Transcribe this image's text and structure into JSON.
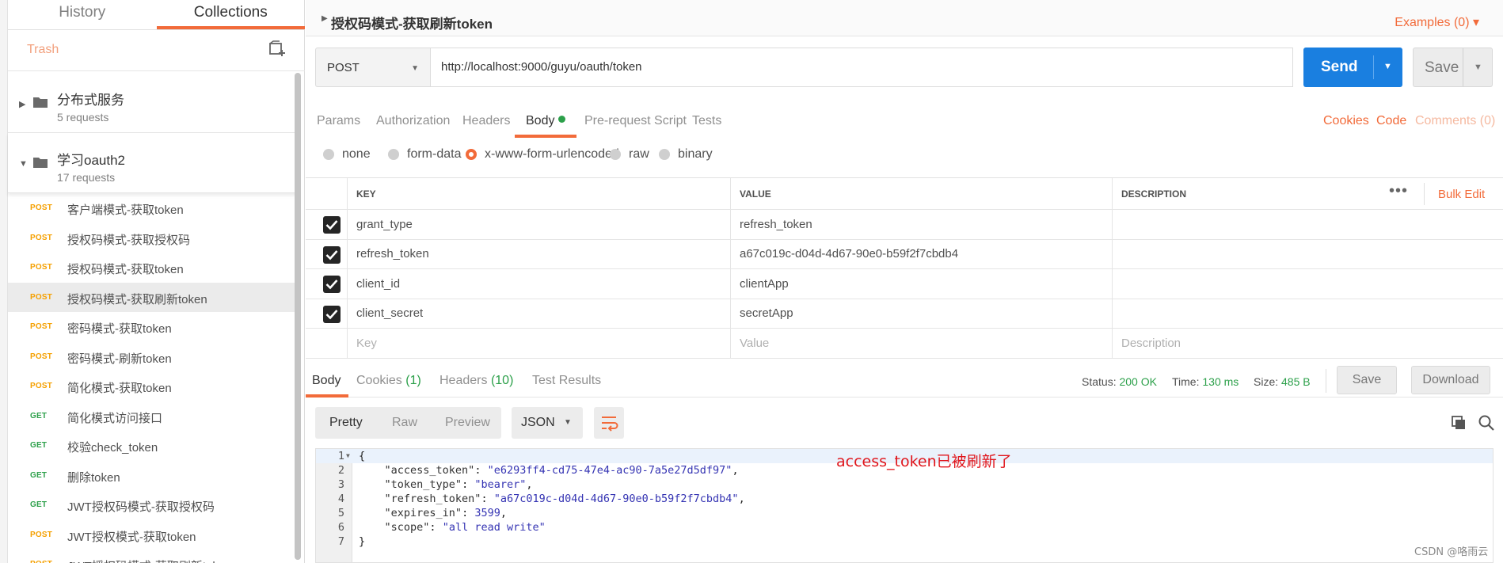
{
  "sidebar": {
    "tabs": [
      "History",
      "Collections"
    ],
    "trash": "Trash",
    "folders": [
      {
        "name": "分布式服务",
        "count": "5 requests"
      },
      {
        "name": "学习oauth2",
        "count": "17 requests"
      }
    ],
    "requests": [
      {
        "method": "POST",
        "name": "客户端模式-获取token"
      },
      {
        "method": "POST",
        "name": "授权码模式-获取授权码"
      },
      {
        "method": "POST",
        "name": "授权码模式-获取token"
      },
      {
        "method": "POST",
        "name": "授权码模式-获取刷新token"
      },
      {
        "method": "POST",
        "name": "密码模式-获取token"
      },
      {
        "method": "POST",
        "name": "密码模式-刷新token"
      },
      {
        "method": "POST",
        "name": "简化模式-获取token"
      },
      {
        "method": "GET",
        "name": "简化模式访问接口"
      },
      {
        "method": "GET",
        "name": "校验check_token"
      },
      {
        "method": "GET",
        "name": "删除token"
      },
      {
        "method": "GET",
        "name": "JWT授权码模式-获取授权码"
      },
      {
        "method": "POST",
        "name": "JWT授权模式-获取token"
      },
      {
        "method": "POST",
        "name": "JWT授权码模式-获取刷新token"
      }
    ]
  },
  "request": {
    "title": "授权码模式-获取刷新token",
    "examples": "Examples (0)",
    "method": "POST",
    "url": "http://localhost:9000/guyu/oauth/token",
    "send_label": "Send",
    "save_label": "Save",
    "tabs": [
      "Params",
      "Authorization",
      "Headers",
      "Body",
      "Pre-request Script",
      "Tests"
    ],
    "right_links": [
      "Cookies",
      "Code",
      "Comments (0)"
    ],
    "body_modes": [
      "none",
      "form-data",
      "x-www-form-urlencoded",
      "raw",
      "binary"
    ],
    "table": {
      "headers": [
        "KEY",
        "VALUE",
        "DESCRIPTION"
      ],
      "bulk_edit": "Bulk Edit",
      "rows": [
        {
          "key": "grant_type",
          "value": "refresh_token"
        },
        {
          "key": "refresh_token",
          "value": "a67c019c-d04d-4d67-90e0-b59f2f7cbdb4"
        },
        {
          "key": "client_id",
          "value": "clientApp"
        },
        {
          "key": "client_secret",
          "value": "secretApp"
        }
      ],
      "placeholder": {
        "key": "Key",
        "value": "Value",
        "desc": "Description"
      }
    }
  },
  "response": {
    "tabs": {
      "body": "Body",
      "cookies": "Cookies",
      "cookies_count": "(1)",
      "headers": "Headers",
      "headers_count": "(10)",
      "tests": "Test Results"
    },
    "status_label": "Status:",
    "status_value": "200 OK",
    "time_label": "Time:",
    "time_value": "130 ms",
    "size_label": "Size:",
    "size_value": "485 B",
    "save_label": "Save",
    "download_label": "Download",
    "formats": [
      "Pretty",
      "Raw",
      "Preview"
    ],
    "lang": "JSON",
    "line_numbers": [
      "1",
      "2",
      "3",
      "4",
      "5",
      "6",
      "7"
    ],
    "json": {
      "access_token_key": "\"access_token\"",
      "access_token_val": "\"e6293ff4-cd75-47e4-ac90-7a5e27d5df97\"",
      "token_type_key": "\"token_type\"",
      "token_type_val": "\"bearer\"",
      "refresh_token_key": "\"refresh_token\"",
      "refresh_token_val": "\"a67c019c-d04d-4d67-90e0-b59f2f7cbdb4\"",
      "expires_in_key": "\"expires_in\"",
      "expires_in_val": "3599",
      "scope_key": "\"scope\"",
      "scope_val": "\"all read write\""
    },
    "annotation": "access_token已被刷新了"
  },
  "watermark": "CSDN @咯雨云",
  "colors": {
    "accent": "#f26b3a",
    "send": "#1a7fe0",
    "get": "#2ca04a",
    "post": "#f5a000"
  }
}
